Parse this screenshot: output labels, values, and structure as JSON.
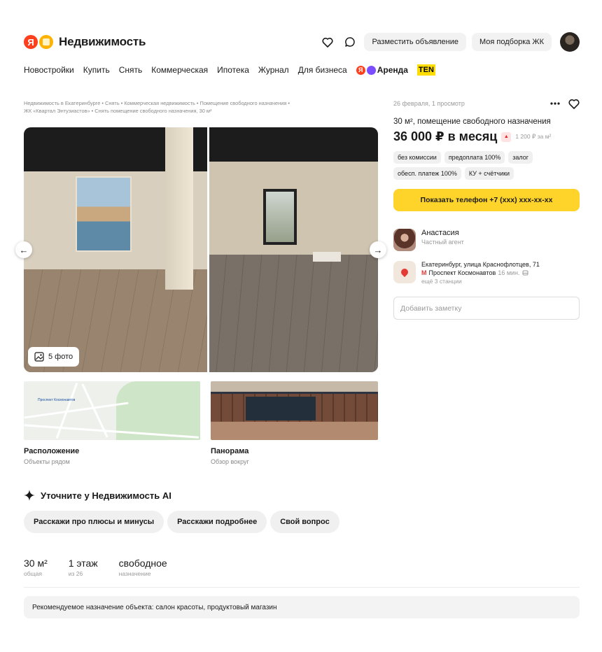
{
  "header": {
    "logo_letter": "Я",
    "logo_text": "Недвижимость",
    "post_ad_label": "Разместить объявление",
    "my_selection_label": "Моя подборка ЖК"
  },
  "nav": {
    "items": [
      "Новостройки",
      "Купить",
      "Снять",
      "Коммерческая",
      "Ипотека",
      "Журнал",
      "Для бизнеса"
    ],
    "arenda_letter": "Я",
    "arenda_label": "Аренда",
    "ten_label": "TEN"
  },
  "breadcrumbs": {
    "line1": "Недвижимость в Екатеринбурге • Снять • Коммерческая недвижимость • Помещение свободного назначения •",
    "line2": "ЖК «Квартал Энтузиастов» • Снять помещение свободного назначения, 30 м²"
  },
  "gallery": {
    "photo_count": "5 фото",
    "arrow_left": "←",
    "arrow_right": "→"
  },
  "thumbs": {
    "location_title": "Расположение",
    "location_sub": "Объекты рядом",
    "map_label": "Проспект Космонавтов",
    "pano_title": "Панорама",
    "pano_sub": "Обзор вокруг"
  },
  "ai": {
    "title": "Уточните у Недвижимость AI",
    "chips": [
      "Расскажи про плюсы и минусы",
      "Расскажи подробнее",
      "Свой вопрос"
    ]
  },
  "stats": [
    {
      "value": "30 м²",
      "label": "общая"
    },
    {
      "value": "1 этаж",
      "label": "из 26"
    },
    {
      "value": "свободное",
      "label": "назначение"
    }
  ],
  "recommendation": "Рекомендуемое назначение объекта: салон красоты, продуктовый магазин",
  "listing": {
    "meta": "26 февраля, 1 просмотр",
    "title": "30 м², помещение свободного назначения",
    "price": "36 000 ₽ в месяц",
    "price_per_m": "1 200 ₽ за м²",
    "tags": [
      "без комиссии",
      "предоплата 100%",
      "залог",
      "обесп. платеж 100%",
      "КУ + счётчики"
    ],
    "phone_button": "Показать телефон +7 (xxx) xxx-xx-xx",
    "agent_name": "Анастасия",
    "agent_role": "Частный агент",
    "address": "Екатеринбург, улица Краснофлотцев, 71",
    "metro_letter": "М",
    "metro": "Проспект Космонавтов",
    "metro_time": "16 мин.",
    "more_stations": "ещё 3 станции",
    "note_placeholder": "Добавить заметку"
  },
  "colors": {
    "yandex_red": "#fc3f1d",
    "phone_button": "#fed42b",
    "metro_red": "#e53935"
  }
}
